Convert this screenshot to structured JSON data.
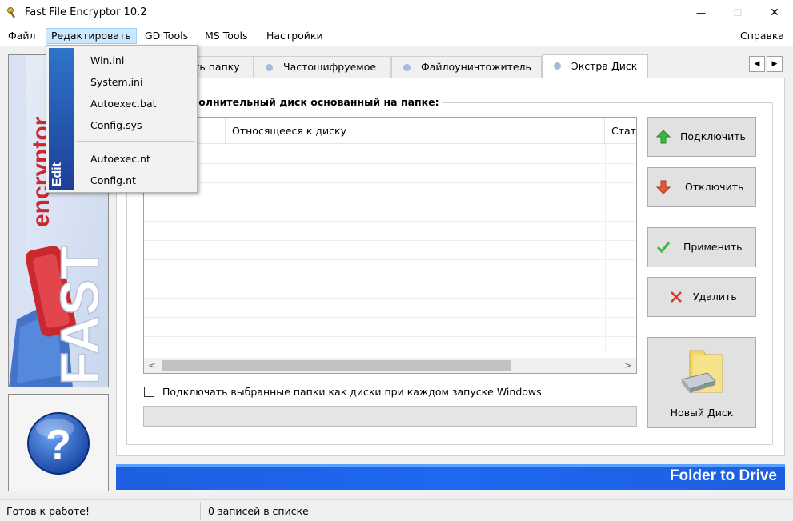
{
  "window": {
    "title": "Fast File Encryptor 10.2",
    "controls": {
      "minimize": "—",
      "maximize": "☐",
      "close": "✕"
    }
  },
  "menubar": {
    "items": [
      "Файл",
      "Редактировать",
      "GD Tools",
      "MS Tools",
      "Настройки"
    ],
    "help": "Справка"
  },
  "edit_menu": {
    "side_label": "Edit",
    "items": [
      "Win.ini",
      "System.ini",
      "Autoexec.bat",
      "Config.sys",
      "Autoexec.nt",
      "Config.nt"
    ]
  },
  "tabs": {
    "items": [
      "ить папку",
      "Частошифруемое",
      "Файлоуничтожитель",
      "Экстра Диск"
    ],
    "selected": "Экстра Диск",
    "scroll_left": "◀",
    "scroll_right": "▶"
  },
  "group": {
    "title": "ополнительный диск основанный на папке:"
  },
  "listview": {
    "columns": [
      "",
      "Относящееся к диску",
      "Стат"
    ],
    "rows": []
  },
  "scrollbar": {
    "left": "<",
    "right": ">"
  },
  "actions": {
    "connect": "Подключить",
    "disconnect": "Отключить",
    "apply": "Применить",
    "delete": "Удалить",
    "new_disk": "Новый Диск"
  },
  "autoconnect": {
    "label": "Подключать выбранные папки как диски при каждом запуске Windows",
    "checked": false
  },
  "sidebar": {
    "logo_top": "encryptor",
    "logo_big": "FAST",
    "help": "?"
  },
  "banner": {
    "text": "Folder to Drive"
  },
  "statusbar": {
    "status": "Готов к работе!",
    "count": "0 записей в списке"
  },
  "colors": {
    "accent": "#1f68f0",
    "menu_highlight": "#cce8ff",
    "green": "#3cb83c",
    "red": "#e05a3a"
  }
}
